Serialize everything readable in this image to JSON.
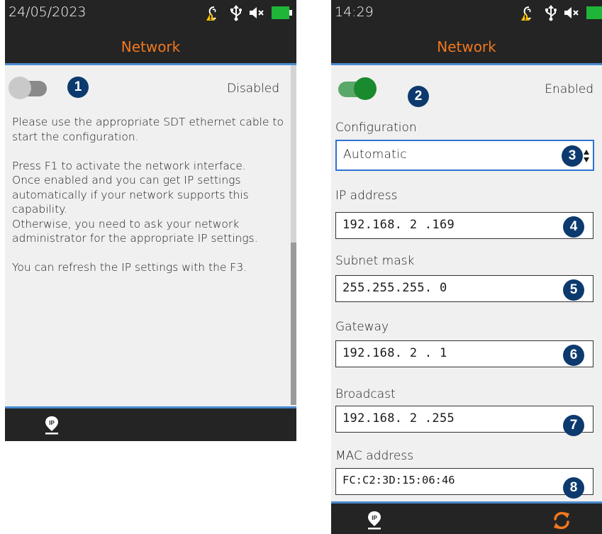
{
  "left_screen": {
    "status": {
      "date": "24/05/2023",
      "title": "Network"
    },
    "toggle": {
      "state": "off",
      "status_label": "Disabled"
    },
    "badge": "1",
    "help": {
      "p1": "Please use the appropriate SDT ethernet cable to start the configuration.",
      "p2": "Press F1 to activate the network interface.\nOnce enabled and you can get IP settings automatically if your network supports this capability.\nOtherwise, you need to ask your network administrator for the appropriate IP settings.",
      "p3": "You can refresh the IP settings with the F3."
    },
    "footer": {
      "icon": "ip-pin-icon"
    }
  },
  "right_screen": {
    "status": {
      "time": "14:29",
      "title": "Network"
    },
    "toggle": {
      "state": "on",
      "status_label": "Enabled"
    },
    "badges": [
      "2",
      "3",
      "4",
      "5",
      "6",
      "7",
      "8"
    ],
    "fields": {
      "configuration": {
        "label": "Configuration",
        "value": "Automatic"
      },
      "ip_address": {
        "label": "IP address",
        "value": "192.168. 2 .169"
      },
      "subnet_mask": {
        "label": "Subnet mask",
        "value": "255.255.255. 0"
      },
      "gateway": {
        "label": "Gateway",
        "value": "192.168. 2 . 1"
      },
      "broadcast": {
        "label": "Broadcast",
        "value": "192.168. 2 .255"
      },
      "mac_address": {
        "label": "MAC address",
        "value": "FC:C2:3D:15:06:46"
      }
    },
    "footer": {
      "left_icon": "ip-pin-icon",
      "right_icon": "refresh-icon"
    }
  },
  "status_icons": [
    "hearing-warning-icon",
    "usb-icon",
    "mute-icon",
    "battery-icon"
  ],
  "colors": {
    "title": "#f07820",
    "accent_blue": "#4a8bd0",
    "badge": "#0d3a6e",
    "toggle_on": "#1a8a2e",
    "battery": "#1fb538",
    "refresh": "#f07820"
  }
}
